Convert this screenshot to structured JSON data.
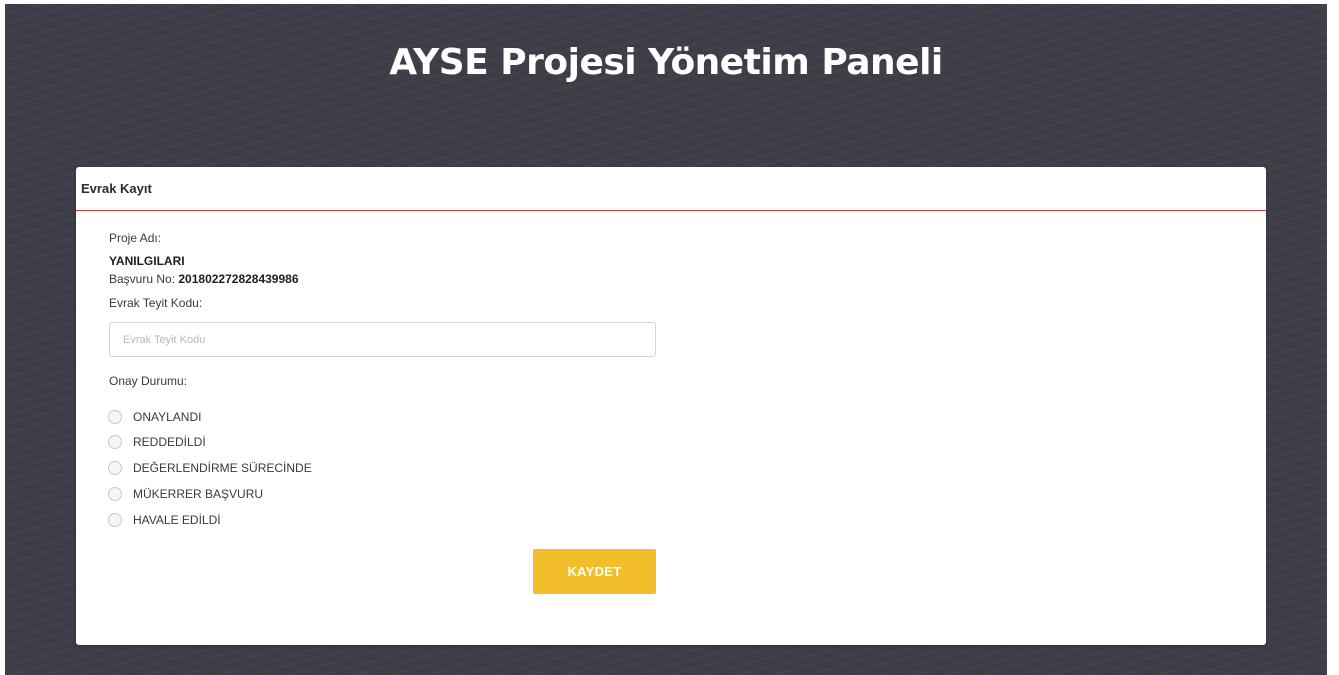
{
  "header": {
    "title": "AYSE Projesi Yönetim Paneli"
  },
  "card": {
    "title": "Evrak Kayıt",
    "project_name_label": "Proje Adı:",
    "project_name_value": "YANILGILARI",
    "application_no_label": "Başvuru No:",
    "application_no_value": "201802272828439986",
    "code_label": "Evrak Teyit Kodu:",
    "code_input": {
      "value": "",
      "placeholder": "Evrak Teyit Kodu"
    },
    "status_label": "Onay Durumu:",
    "status_options": [
      {
        "label": "ONAYLANDI",
        "checked": false
      },
      {
        "label": "REDDEDİLDİ",
        "checked": false
      },
      {
        "label": "DEĞERLENDİRME SÜRECİNDE",
        "checked": false
      },
      {
        "label": "MÜKERRER BAŞVURU",
        "checked": false
      },
      {
        "label": "HAVALE EDİLDİ",
        "checked": false
      }
    ],
    "save_label": "KAYDET"
  },
  "colors": {
    "background": "#3f3e48",
    "header_divider": "#d9323f",
    "save_button": "#f2be2b"
  }
}
